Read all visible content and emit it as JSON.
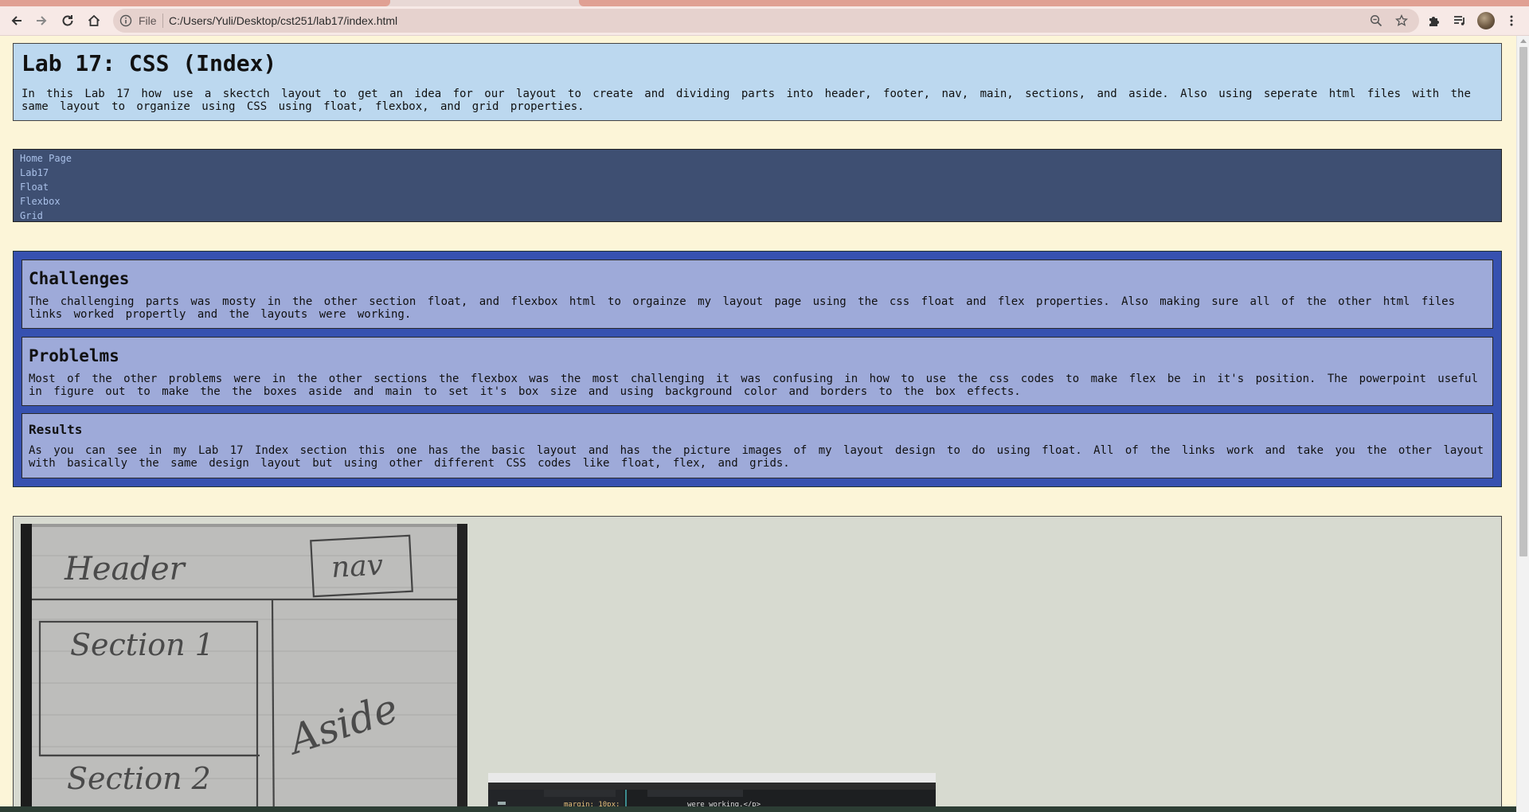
{
  "browser": {
    "file_label": "File",
    "url": "C:/Users/Yuli/Desktop/cst251/lab17/index.html"
  },
  "header": {
    "title": "Lab 17: CSS (Index)",
    "description": "In this Lab 17 how use a skectch layout to get an idea for our layout to create and dividing parts into header, footer, nav, main, sections, and aside. Also using seperate html files with the same layout to organize using CSS using float, flexbox, and grid properties."
  },
  "nav": {
    "items": [
      {
        "label": "Home Page"
      },
      {
        "label": "Lab17"
      },
      {
        "label": "Float"
      },
      {
        "label": "Flexbox"
      },
      {
        "label": "Grid"
      }
    ]
  },
  "main": {
    "sections": [
      {
        "heading": "Challenges",
        "text": "The challenging parts was mosty in the other section float, and flexbox html to orgainze my layout page using the css float and flex properties. Also making sure all of the other html files links worked propertly and the layouts were working."
      },
      {
        "heading": "Problelms",
        "text": "Most of the other problems were in the other sections the flexbox was the most challenging it was confusing in how to use the css codes to make flex be in it's position. The powerpoint useful in figure out to make the the boxes aside and main to set it's box size and using background color and borders to the box effects."
      },
      {
        "heading": "Results",
        "text": "As you can see in my Lab 17 Index section this one has the basic layout and has the picture images of my layout design to do using float. All of the links work and take you the other layout with basically the same design layout but using other different CSS codes like float, flex, and grids."
      }
    ]
  },
  "aside": {
    "sketch_labels": [
      "Header",
      "nav",
      "Section 1",
      "Aside",
      "Section 2"
    ],
    "editor_code_left": "margin: 10px;",
    "editor_code_right": "were working.</p>"
  },
  "colors": {
    "page_bg": "#fcf5d8",
    "header_bg": "#bcd8ef",
    "nav_bg": "#3e4f72",
    "nav_link": "#a9c0e8",
    "main_bg": "#3651b0",
    "section_bg": "#9eaad9",
    "aside_bg": "#d7dad0"
  }
}
